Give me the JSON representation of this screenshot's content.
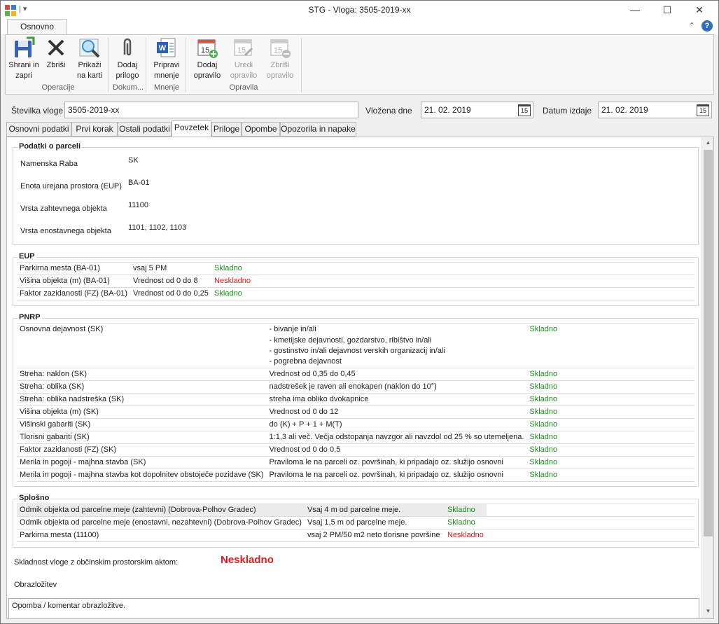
{
  "window": {
    "title": "STG - Vloga: 3505-2019-xx",
    "qat": "| ▾",
    "minimize": "—",
    "maximize": "☐",
    "close": "✕"
  },
  "ribbon": {
    "tab": "Osnovno",
    "buttons": {
      "save": "Shrani in zapri",
      "delete": "Zbriši",
      "map": "Prikaži na karti",
      "attach": "Dodaj prilogo",
      "opinion": "Pripravi mnenje",
      "add_task": "Dodaj opravilo",
      "edit_task": "Uredi opravilo",
      "del_task": "Zbriši opravilo"
    },
    "groups": {
      "operations": "Operacije",
      "documents": "Dokum...",
      "opinion": "Mnenje",
      "tasks": "Opravila"
    }
  },
  "header": {
    "number_label": "Številka vloge",
    "number_value": "3505-2019-xx",
    "filed_label": "Vložena dne",
    "filed_value": "21. 02. 2019",
    "issued_label": "Datum izdaje",
    "issued_value": "21. 02. 2019",
    "calendar_day": "15"
  },
  "tabs": [
    "Osnovni podatki",
    "Prvi korak",
    "Ostali podatki",
    "Povzetek",
    "Priloge",
    "Opombe",
    "Opozorila in napake"
  ],
  "parcel": {
    "title": "Podatki o parceli",
    "rows": [
      {
        "label": "Namenska Raba",
        "value": "SK"
      },
      {
        "label": "Enota urejana prostora (EUP)",
        "value": "BA-01"
      },
      {
        "label": "Vrsta zahtevnega objekta",
        "value": "11100"
      },
      {
        "label": "Vrsta enostavnega objekta",
        "value": "1101, 1102, 1103"
      }
    ]
  },
  "eup": {
    "title": "EUP",
    "rows": [
      {
        "name": "Parkirna mesta (BA-01)",
        "req": "vsaj 5 PM",
        "status": "Skladno"
      },
      {
        "name": "Višina objekta (m) (BA-01)",
        "req": "Vrednost od 0 do 8",
        "status": "Neskladno"
      },
      {
        "name": "Faktor zazidanosti (FZ) (BA-01)",
        "req": "Vrednost od 0 do 0,25",
        "status": "Skladno"
      }
    ]
  },
  "pnrp": {
    "title": "PNRP",
    "rows": [
      {
        "name": "Osnovna dejavnost (SK)",
        "req": "- bivanje in/ali",
        "status": "Skladno"
      },
      {
        "name": "",
        "req": "- kmetijske dejavnosti, gozdarstvo, ribištvo in/ali",
        "status": ""
      },
      {
        "name": "",
        "req": "- gostinstvo in/ali dejavnost verskih organizacij in/ali",
        "status": ""
      },
      {
        "name": "",
        "req": "- pogrebna dejavnost",
        "status": ""
      },
      {
        "name": "Streha: naklon (SK)",
        "req": "Vrednost od 0,35 do 0,45",
        "status": "Skladno"
      },
      {
        "name": "Streha: oblika (SK)",
        "req": "nadstrešek je raven ali enokapen (naklon do 10°)",
        "status": "Skladno"
      },
      {
        "name": "Streha: oblika nadstreška (SK)",
        "req": "streha ima obliko dvokapnice",
        "status": "Skladno"
      },
      {
        "name": "Višina objekta (m) (SK)",
        "req": "Vrednost od 0 do 12",
        "status": "Skladno"
      },
      {
        "name": "Višinski gabariti (SK)",
        "req": "do (K) + P + 1 + M(T)",
        "status": "Skladno"
      },
      {
        "name": "Tlorisni gabariti (SK)",
        "req": "1:1,3 ali več. Večja odstopanja navzgor ali navzdol od 25 % so utemeljena.",
        "status": "Skladno"
      },
      {
        "name": "Faktor zazidanosti (FZ) (SK)",
        "req": "Vrednost od 0 do 0,5",
        "status": "Skladno"
      },
      {
        "name": "Merila in pogoji - majhna stavba (SK)",
        "req": "Praviloma le na parceli oz. površinah, ki pripadajo oz. služijo osnovni",
        "status": "Skladno"
      },
      {
        "name": "Merila in pogoji - majhna stavba kot dopolnitev obstoječe pozidave (SK)",
        "req": "Praviloma le na parceli oz. površinah, ki pripadajo oz. služijo osnovni",
        "status": "Skladno"
      }
    ]
  },
  "general": {
    "title": "Splošno",
    "rows": [
      {
        "name": "Odmik objekta od parcelne meje (zahtevni) (Dobrova-Polhov Gradec)",
        "req": "Vsaj 4 m od parcelne meje.",
        "status": "Skladno"
      },
      {
        "name": "Odmik objekta od parcelne meje (enostavni, nezahtevni) (Dobrova-Polhov Gradec)",
        "req": "Vsaj 1,5 m od parcelne meje.",
        "status": "Skladno"
      },
      {
        "name": "Parkirna mesta (11100)",
        "req": "vsaj 2 PM/50 m2 neto tlorisne površine",
        "status": "Neskladno"
      }
    ]
  },
  "summary": {
    "label": "Skladnost vloge z občinskim prostorskim aktom:",
    "result": "Neskladno",
    "explanation_label": "Obrazložitev",
    "comment_placeholder": "Opomba / komentar obrazložitve."
  },
  "colors": {
    "ok": "#1e8b1e",
    "bad": "#e01b1b",
    "accent": "#2f6db5"
  }
}
